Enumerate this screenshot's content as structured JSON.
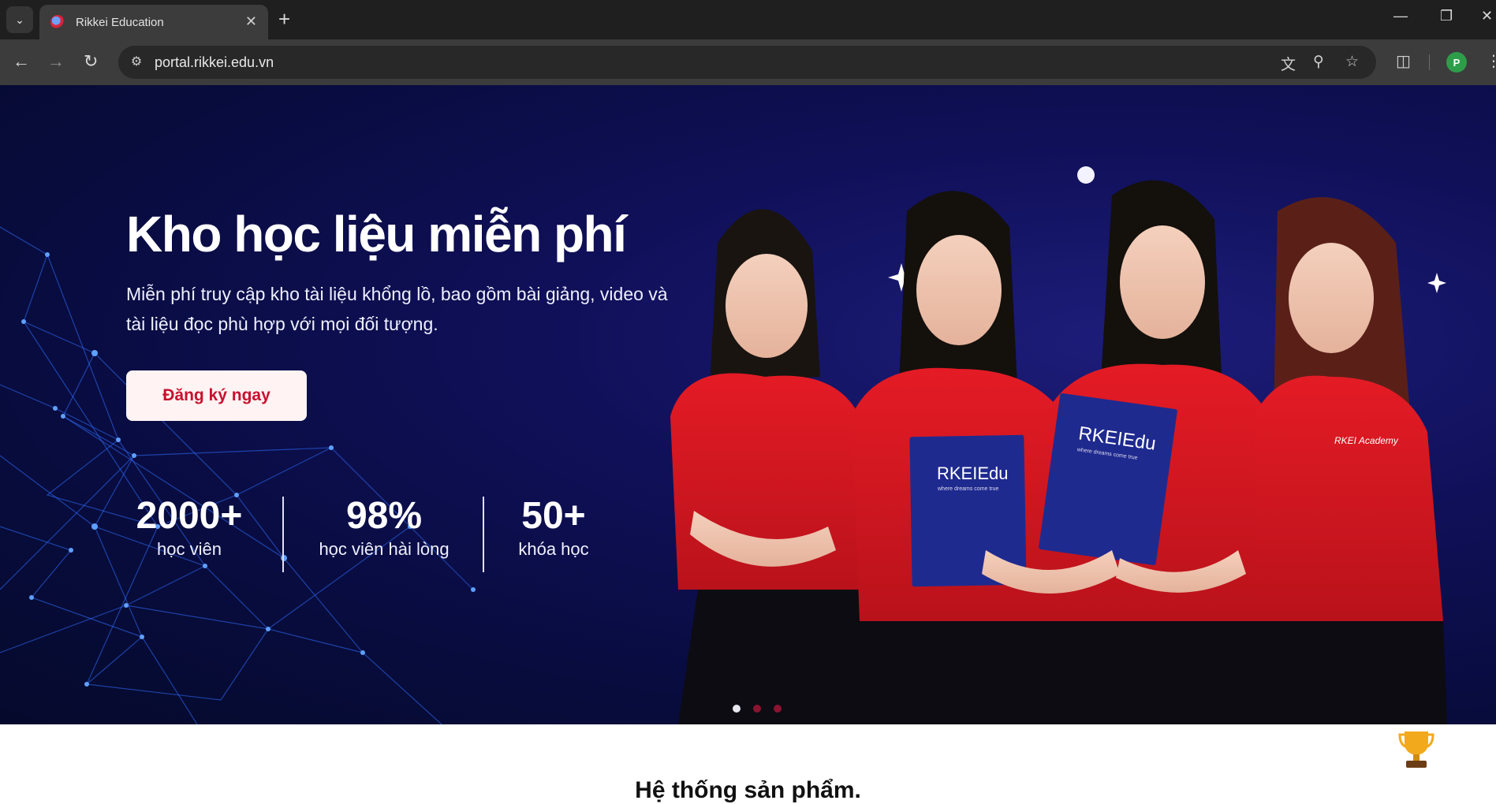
{
  "browser": {
    "tab_title": "Rikkei Education",
    "url": "portal.rikkei.edu.vn",
    "profile_initial": "P"
  },
  "hero": {
    "title": "Kho học liệu miễn phí",
    "subtitle": "Miễn phí truy cập kho tài liệu khổng lồ, bao gồm bài giảng, video và tài liệu đọc phù hợp với mọi đối tượng.",
    "cta_label": "Đăng ký ngay",
    "stats": [
      {
        "value": "2000+",
        "label": "học viên"
      },
      {
        "value": "98%",
        "label": "học viên hài lòng"
      },
      {
        "value": "50+",
        "label": "khóa học"
      }
    ],
    "folder_brand": "RKEIEdu",
    "folder_tagline": "where dreams come true",
    "shirt_brand": "RKEI Academy",
    "carousel": {
      "active_index": 0,
      "count": 3
    }
  },
  "products": {
    "section_title": "Hệ thống sản phẩm."
  },
  "colors": {
    "accent_red": "#c8102e",
    "hero_bg": "#0b0f4a",
    "folder_blue": "#1f2a8f"
  }
}
